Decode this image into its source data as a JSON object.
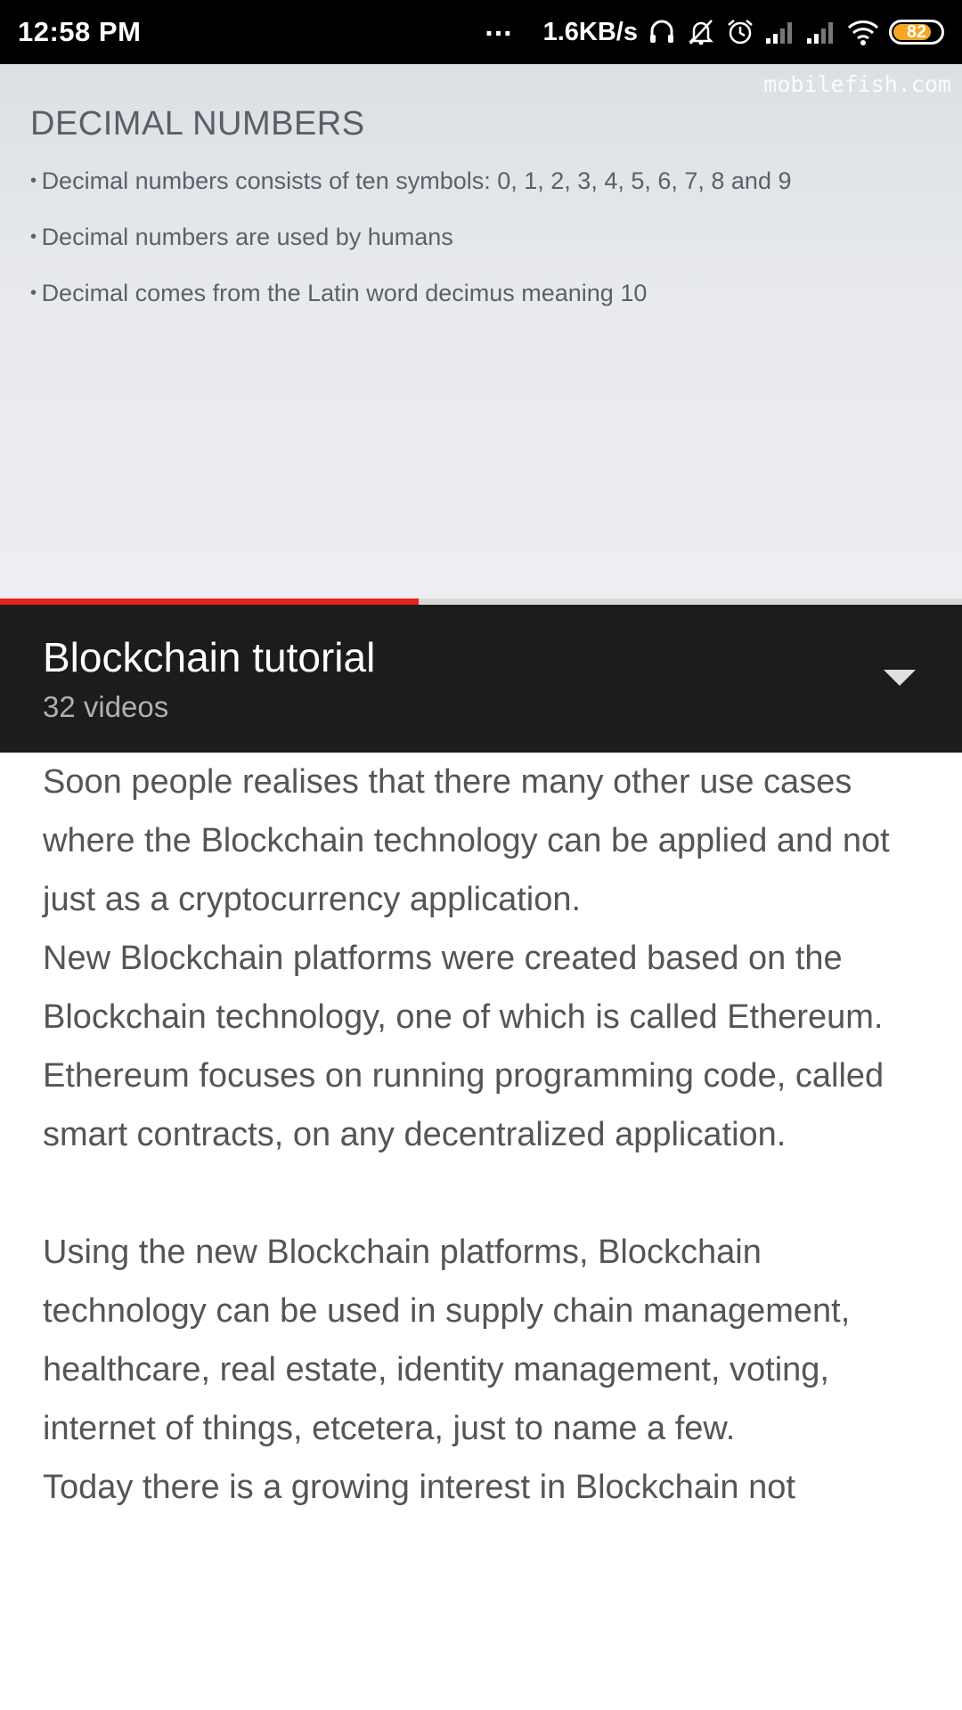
{
  "status_bar": {
    "time": "12:58 PM",
    "dots": "...",
    "network_speed": "1.6KB/s",
    "battery_level": "82",
    "icons": [
      "headphones-icon",
      "mute-icon",
      "alarm-icon",
      "signal-icon",
      "signal-icon",
      "wifi-icon",
      "battery-icon"
    ]
  },
  "video": {
    "watermark": "mobilefish.com",
    "slide_title": "DECIMAL NUMBERS",
    "bullets": [
      "Decimal numbers consists of ten symbols: 0, 1, 2, 3, 4, 5, 6, 7, 8 and 9",
      "Decimal numbers are used by humans",
      "Decimal comes from the Latin word decimus meaning 10"
    ],
    "progress_fraction": 0.435,
    "progress_color": "#e62117"
  },
  "playlist": {
    "title": "Blockchain tutorial",
    "count": "32 videos",
    "toggle_icon": "caret-down-icon"
  },
  "description": {
    "paragraphs": [
      "Soon people realises that there many other use cases where the Blockchain technology can be applied and not just as a cryptocurrency application.",
      "New Blockchain platforms were created based on the Blockchain technology, one of which is called Ethereum.",
      "Ethereum focuses on running programming code, called smart contracts, on any decentralized application.",
      "",
      "Using the new Blockchain platforms, Blockchain technology can be used in supply chain management, healthcare, real estate, identity management, voting, internet of things, etcetera, just to name a few.",
      "Today there is a growing interest in Blockchain not"
    ]
  }
}
